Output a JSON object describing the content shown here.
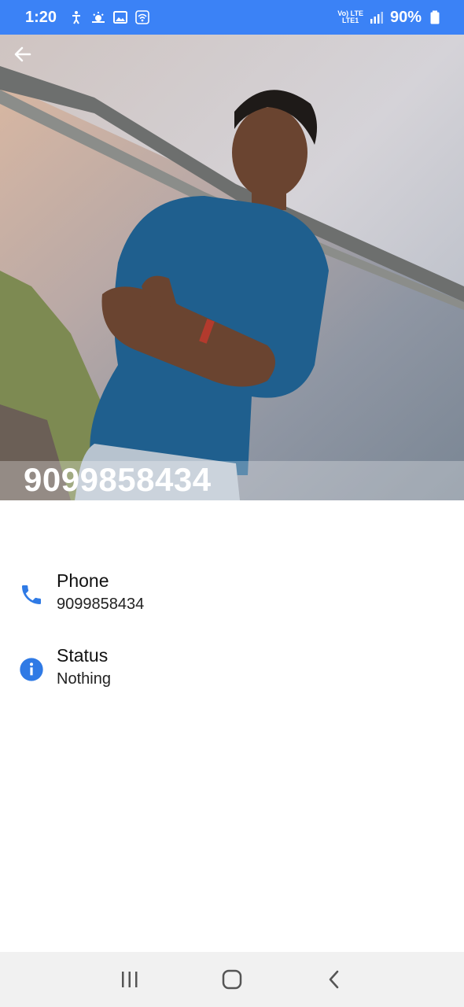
{
  "status_bar": {
    "time": "1:20",
    "network_top": "Vo) LTE",
    "network_bottom": "LTE1",
    "battery": "90%",
    "icons": [
      "accessibility-icon",
      "weather-icon",
      "gallery-icon",
      "wifi-icon",
      "signal-icon",
      "battery-icon"
    ]
  },
  "header": {
    "back_icon": "arrow-left-icon",
    "title": "9099858434"
  },
  "details": [
    {
      "icon": "phone-icon",
      "label": "Phone",
      "value": "9099858434"
    },
    {
      "icon": "info-icon",
      "label": "Status",
      "value": "Nothing"
    }
  ],
  "navigation": {
    "recents_icon": "recents-icon",
    "home_icon": "home-icon",
    "back_icon": "chevron-left-icon"
  },
  "colors": {
    "status_bar": "#3b82f6",
    "accent": "#2f7ae5",
    "nav_bar": "#f1f1f1"
  }
}
